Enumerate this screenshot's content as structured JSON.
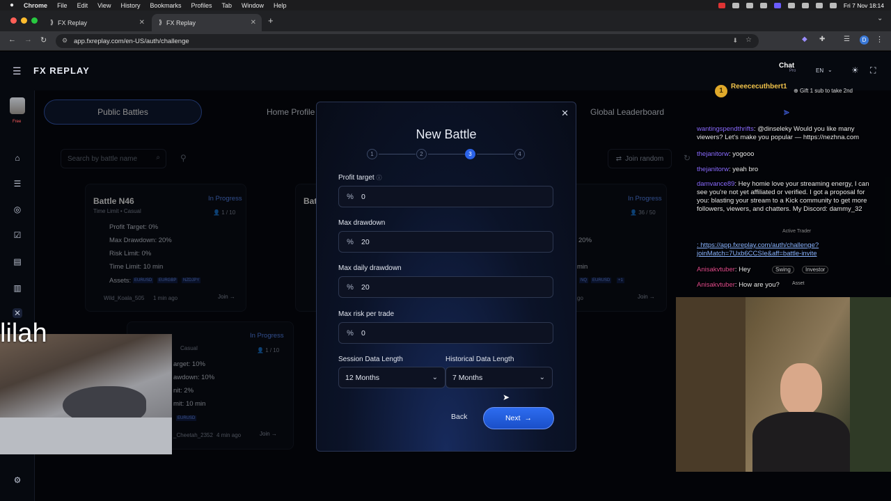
{
  "menubar": {
    "apple": "",
    "items": [
      "Chrome",
      "File",
      "Edit",
      "View",
      "History",
      "Bookmarks",
      "Profiles",
      "Tab",
      "Window",
      "Help"
    ],
    "datetime": "Fri 7 Nov 18:14"
  },
  "browser": {
    "tabs": [
      {
        "label": "FX Replay"
      },
      {
        "label": "FX Replay"
      }
    ],
    "url": "app.fxreplay.com/en-US/auth/challenge",
    "profile_initial": "D"
  },
  "app": {
    "logo": "FX REPLAY",
    "chat_label": "Chat",
    "pro_label": "Pro",
    "lang": "EN",
    "user_tag": "Free",
    "nav": {
      "public_battles": "Public Battles",
      "home_profile": "Home Profile",
      "global_leaderboard": "Global Leaderboard"
    },
    "search_placeholder": "Search by battle name",
    "join_random": "Join random",
    "cards": [
      {
        "title": "Battle N46",
        "status": "In Progress",
        "meta_left": "Time Limit",
        "meta_right": "Casual",
        "players": "1 / 10",
        "profit_target": "Profit Target: 0%",
        "max_drawdown": "Max Drawdown: 20%",
        "risk_limit": "Risk Limit: 0%",
        "time_limit": "Time Limit: 10 min",
        "assets_label": "Assets:",
        "assets": [
          "EURUSD",
          "EURGBP",
          "NZDJPY"
        ],
        "host": "Wild_Koala_505",
        "ago": "1 min ago",
        "join": "Join"
      },
      {
        "title": "Bat",
        "status": "",
        "players": "",
        "host": "",
        "ago": ""
      },
      {
        "title": "",
        "status": "In Progress",
        "players": "36 / 50",
        "max_drawdown": "20%",
        "time_limit": "min",
        "assets": [
          "NQ",
          "EURUSD",
          "+1"
        ],
        "ago": "go",
        "join": "Join"
      },
      {
        "title": "",
        "status": "In Progress",
        "meta_right": "Casual",
        "players": "1 / 10",
        "profit_target": "arget: 10%",
        "max_drawdown": "awdown: 10%",
        "risk_limit": "nit: 2%",
        "time_limit": "mit: 10 min",
        "assets": [
          "EURUSD"
        ],
        "host": "_Cheetah_2352",
        "ago": "4 min ago",
        "join": "Join"
      }
    ]
  },
  "modal": {
    "title": "New Battle",
    "steps": [
      "1",
      "2",
      "3",
      "4"
    ],
    "active_step": 3,
    "fields": [
      {
        "label": "Profit target",
        "value": "0"
      },
      {
        "label": "Max drawdown",
        "value": "20"
      },
      {
        "label": "Max daily drawdown",
        "value": "20"
      },
      {
        "label": "Max risk per trade",
        "value": "0"
      }
    ],
    "session_label": "Session Data Length",
    "session_value": "12 Months",
    "historical_label": "Historical Data Length",
    "historical_value": "7 Months",
    "back": "Back",
    "next": "Next"
  },
  "overlay": {
    "cam_text": "lilah",
    "top_user": "Reeececuthbert1",
    "top_rank": "1",
    "gift_text": "Gift 1 sub to take 2nd",
    "messages": [
      {
        "user": "wantingspendthrifts",
        "text": ": @dinseleky Would you like many viewers? Let's make you popular — https://nezhna.com"
      },
      {
        "user": "thejanitorw",
        "text": ": yogooo"
      },
      {
        "user": "thejanitorw",
        "text": ": yeah bro"
      },
      {
        "user": "damvance89",
        "text": ": Hey homie love your streaming energy, I can see you're not yet affiliated or verified. I got a proposal for you: blasting your stream to a Kick community to get more followers, viewers, and chatters. My Discord: dammy_32"
      },
      {
        "user": "",
        "text": ": https://app.fxreplay.com/auth/challenge?joinMatch=7Uxb6CCSIe&aff=battle-invite"
      },
      {
        "user": "Anisakvtuber",
        "text": ": Hey"
      },
      {
        "user": "Anisakvtuber",
        "text": ": How are you?"
      }
    ],
    "tags": [
      "Active Trader",
      "Swing",
      "Investor",
      "Asset"
    ]
  }
}
